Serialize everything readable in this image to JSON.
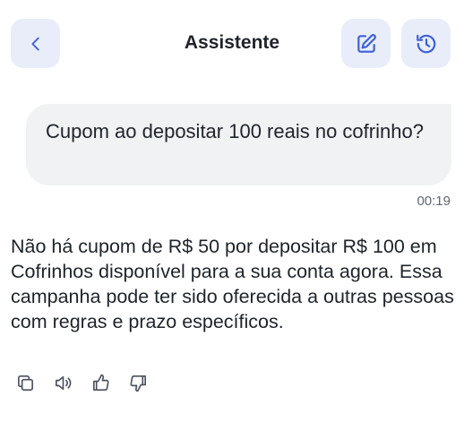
{
  "header": {
    "title": "Assistente",
    "back_icon": "chevron-left-icon",
    "edit_icon": "edit-icon",
    "history_icon": "history-icon"
  },
  "conversation": {
    "user_message": "Cupom ao depositar 100 reais no cofrinho?",
    "user_time": "00:19",
    "assistant_message": "Não há cupom de R$ 50 por depositar R$ 100 em Cofrinhos disponível para a sua conta agora. Essa campanha pode ter sido oferecida a outras pessoas com regras e prazo específicos."
  },
  "actions": [
    "copy-icon",
    "speaker-icon",
    "thumbs-up-icon",
    "thumbs-down-icon"
  ],
  "colors": {
    "accent": "#3d5fd8",
    "button_bg": "#e8edf9",
    "bubble_bg": "#f1f2f4",
    "text": "#1f232b"
  }
}
